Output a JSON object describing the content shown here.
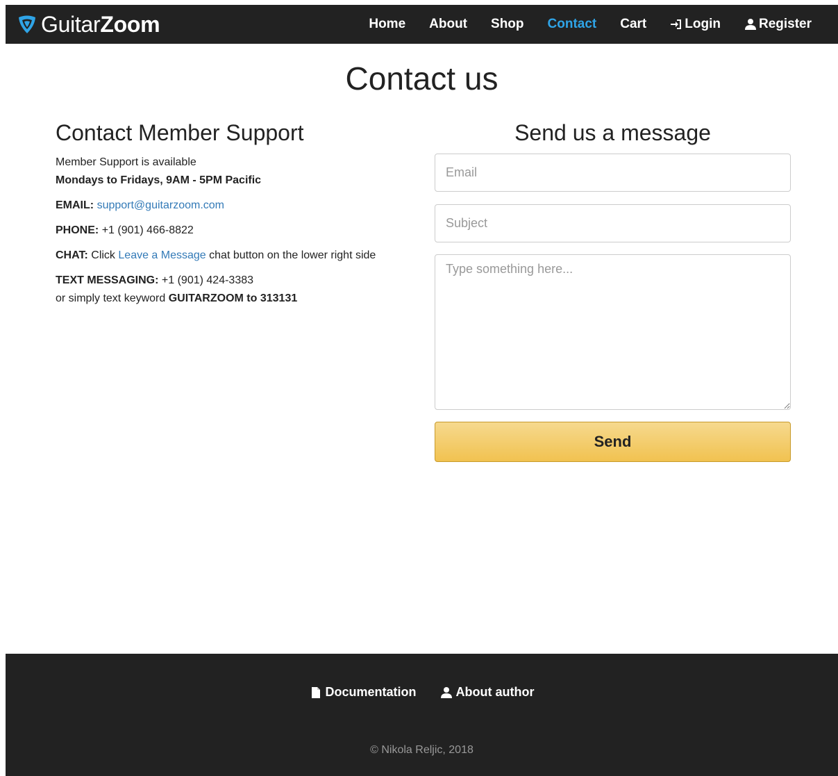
{
  "navbar": {
    "brand_light": "Guitar",
    "brand_bold": "Zoom",
    "items": [
      {
        "label": "Home"
      },
      {
        "label": "About"
      },
      {
        "label": "Shop"
      },
      {
        "label": "Contact",
        "active": true
      },
      {
        "label": "Cart"
      },
      {
        "label": "Login",
        "icon": "login-icon"
      },
      {
        "label": "Register",
        "icon": "user-icon"
      }
    ],
    "active_color": "#2fa4e7",
    "background": "#222222"
  },
  "page": {
    "title": "Contact us"
  },
  "support": {
    "heading": "Contact Member Support",
    "availability_text": "Member Support is available",
    "hours": "Mondays to Fridays, 9AM - 5PM Pacific",
    "email_label": "EMAIL:",
    "email_value": "support@guitarzoom.com",
    "phone_label": "PHONE:",
    "phone_value": "+1 (901) 466-8822",
    "chat_label": "CHAT:",
    "chat_prefix": "Click",
    "chat_link": "Leave a Message",
    "chat_suffix": "chat button on the lower right side",
    "text_label": "TEXT MESSAGING:",
    "text_value": "+1 (901) 424-3383",
    "text_or": "or simply text keyword",
    "text_keyword": "GUITARZOOM to 313131"
  },
  "form": {
    "heading": "Send us a message",
    "email_placeholder": "Email",
    "subject_placeholder": "Subject",
    "message_placeholder": "Type something here...",
    "send_label": "Send",
    "button_color": "#f1c250"
  },
  "footer": {
    "documentation_label": "Documentation",
    "about_author_label": "About author",
    "copyright": "© Nikola Reljic, 2018"
  }
}
